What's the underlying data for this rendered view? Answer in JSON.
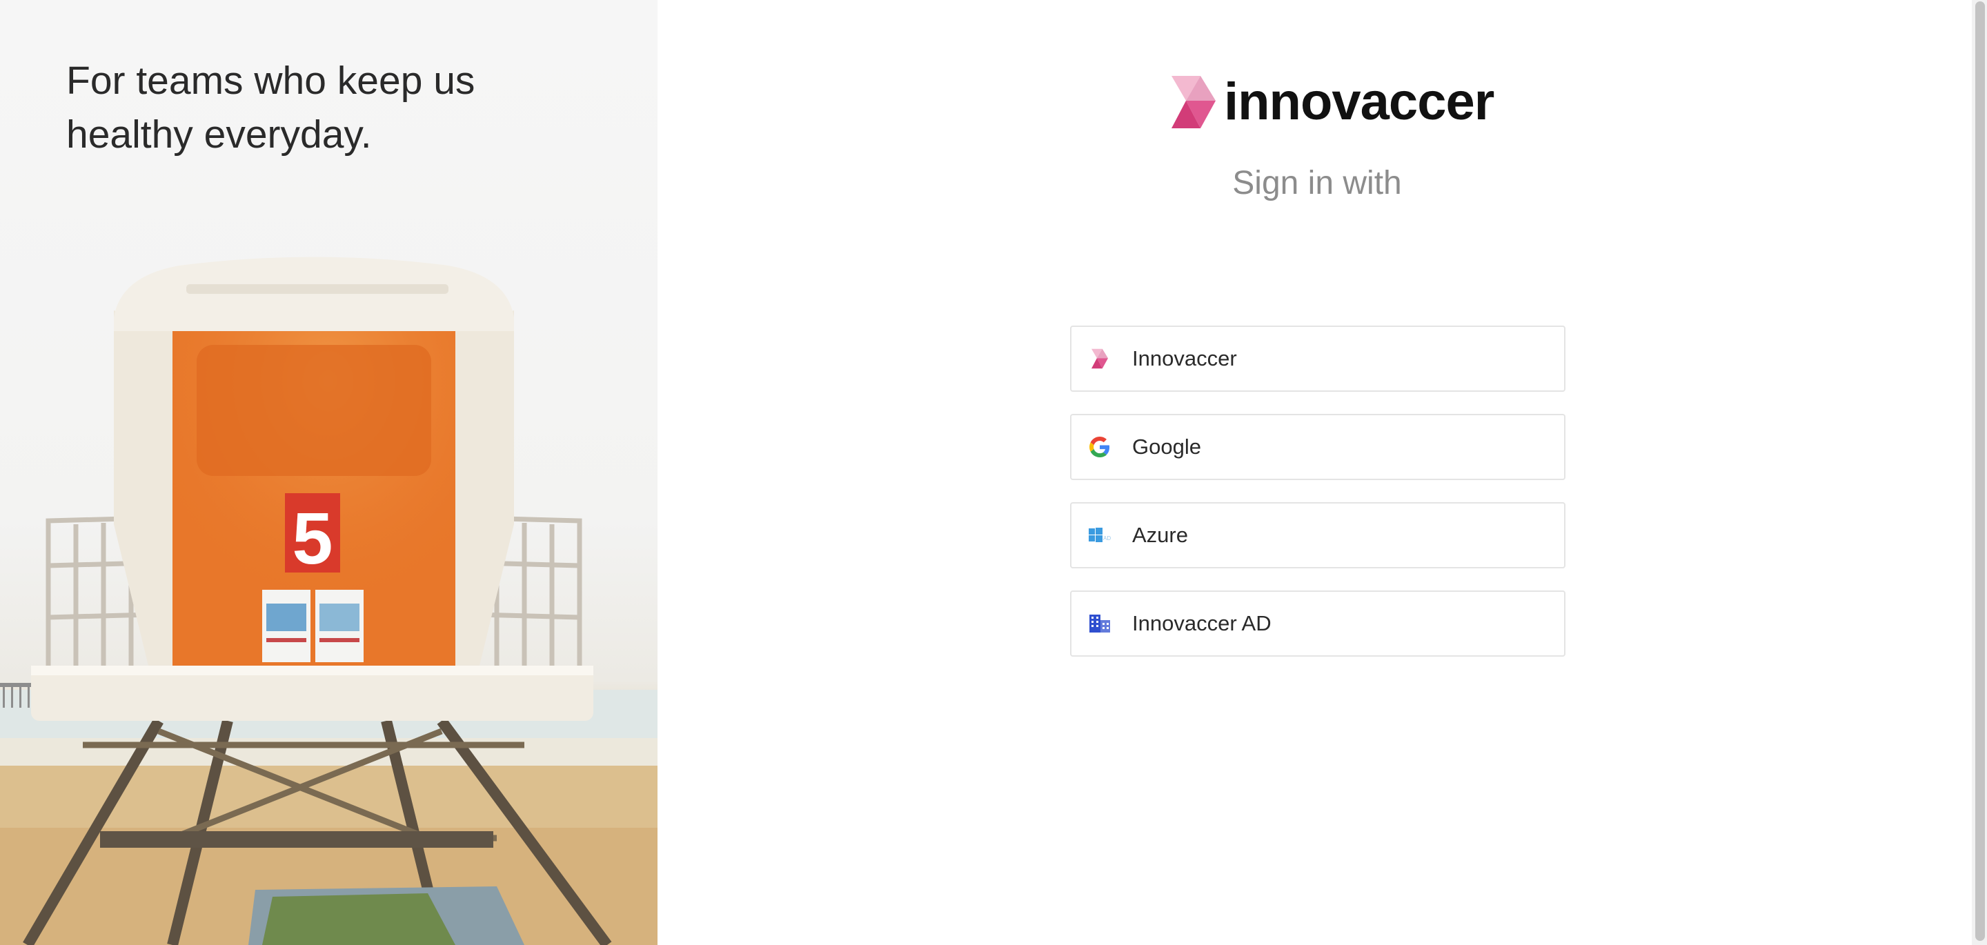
{
  "hero": {
    "tagline_line1": "For teams who keep us",
    "tagline_line2": "healthy everyday.",
    "tower_number": "5"
  },
  "logo": {
    "wordmark": "innovaccer"
  },
  "signin": {
    "title": "Sign in with",
    "providers": [
      {
        "label": "Innovaccer",
        "icon": "innovaccer-logo-icon"
      },
      {
        "label": "Google",
        "icon": "google-icon"
      },
      {
        "label": "Azure",
        "icon": "azure-windows-icon"
      },
      {
        "label": "Innovaccer AD",
        "icon": "building-icon"
      }
    ]
  },
  "colors": {
    "brand_pink": "#d23c78",
    "brand_light_pink": "#f3b2cb",
    "title_gray": "#8c8c8c",
    "border_gray": "#e4e4e4",
    "tower_orange": "#e8772a"
  }
}
